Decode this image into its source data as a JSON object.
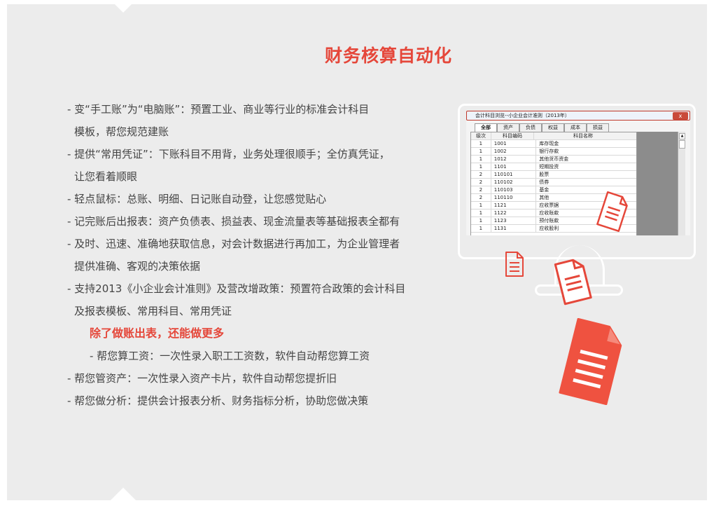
{
  "title": "财务核算自动化",
  "features": [
    {
      "lines": [
        "- 变“手工账”为“电脑账”：预置工业、商业等行业的标准会计科目",
        "模板，帮您规范建账"
      ]
    },
    {
      "lines": [
        "- 提供“常用凭证”：下账科目不用背，业务处理很顺手；全仿真凭证，",
        "让您看着顺眼"
      ]
    },
    {
      "lines": [
        "- 轻点鼠标：总账、明细、日记账自动登，让您感觉贴心"
      ]
    },
    {
      "lines": [
        "- 记完账后出报表：资产负债表、损益表、现金流量表等基础报表全都有"
      ]
    },
    {
      "lines": [
        "- 及时、迅速、准确地获取信息，对会计数据进行再加工，为企业管理者",
        "提供准确、客观的决策依据"
      ]
    },
    {
      "lines": [
        "- 支持2013《小企业会计准则》及营改增政策：预置符合政策的会计科目",
        "及报表模板、常用科目、常用凭证"
      ]
    }
  ],
  "highlight": "除了做账出表，还能做更多",
  "sub_feature": "- 帮您算工资：一次性录入职工工资数，软件自动帮您算工资",
  "extra_features": [
    "- 帮您管资产：一次性录入资产卡片，软件自动帮您提折旧",
    "- 帮您做分析：提供会计报表分析、财务指标分析，协助您做决策"
  ],
  "screen": {
    "window_title": "会计科目浏览--小企业会计准则（2013年）",
    "close_label": "x",
    "tabs": [
      "全部",
      "资产",
      "负债",
      "权益",
      "成本",
      "损益"
    ],
    "columns": [
      "级次",
      "科目编码",
      "科目名称"
    ],
    "rows": [
      [
        "1",
        "1001",
        "库存现金"
      ],
      [
        "1",
        "1002",
        "银行存款"
      ],
      [
        "1",
        "1012",
        "其他货币资金"
      ],
      [
        "1",
        "1101",
        "短期投资"
      ],
      [
        "2",
        "110101",
        "股票"
      ],
      [
        "2",
        "110102",
        "债券"
      ],
      [
        "2",
        "110103",
        "基金"
      ],
      [
        "2",
        "110110",
        "其他"
      ],
      [
        "1",
        "1121",
        "应收票据"
      ],
      [
        "1",
        "1122",
        "应收账款"
      ],
      [
        "1",
        "1123",
        "预付账款"
      ],
      [
        "1",
        "1131",
        "应收股利"
      ]
    ]
  },
  "colors": {
    "accent": "#e5473a",
    "panel": "#ececec",
    "text": "#444444"
  },
  "icons": [
    "document-icon",
    "document-icon",
    "document-icon",
    "document-icon"
  ]
}
